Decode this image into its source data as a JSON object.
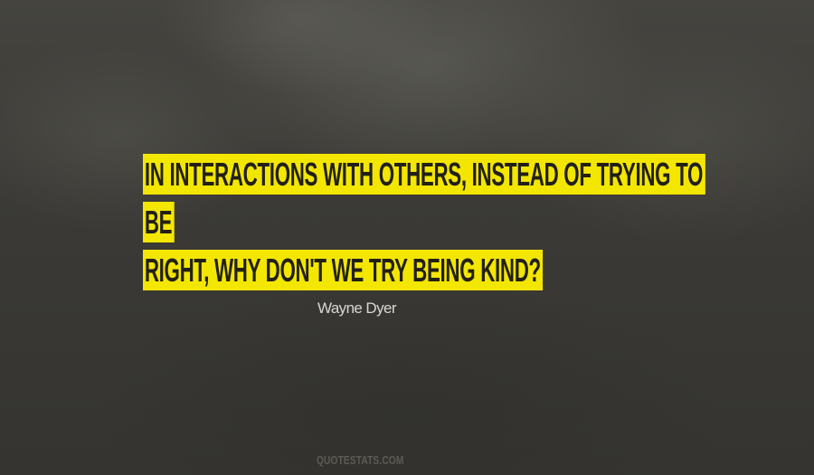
{
  "quote": {
    "lines": [
      "In interactions with others, instead of trying to be",
      "right, why don't we try being kind?"
    ],
    "highlight_color": "#f3e600"
  },
  "author": {
    "name": "Wayne Dyer"
  },
  "watermark": {
    "text": "QUOTESTATS.COM"
  }
}
